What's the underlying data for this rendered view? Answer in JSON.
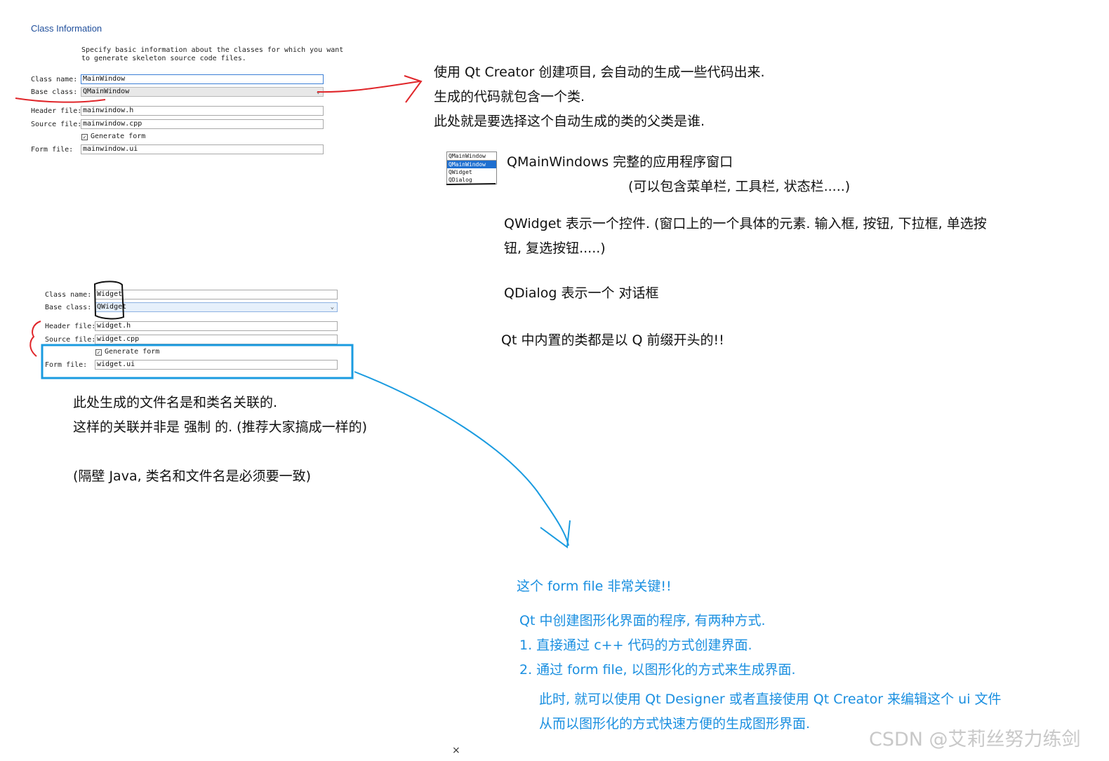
{
  "dialog1": {
    "title": "Class Information",
    "description_line1": "Specify basic information about the classes for which you want",
    "description_line2": "to generate skeleton source code files.",
    "class_name_label": "Class name:",
    "class_name_value": "MainWindow",
    "base_class_label": "Base class:",
    "base_class_value": "QMainWindow",
    "header_file_label": "Header file:",
    "header_file_value": "mainwindow.h",
    "source_file_label": "Source file:",
    "source_file_value": "mainwindow.cpp",
    "generate_form_label": "Generate form",
    "form_file_label": "Form file:",
    "form_file_value": "mainwindow.ui"
  },
  "dropdown": {
    "options": [
      "QMainWindow",
      "QMainWindow",
      "QWidget",
      "QDialog"
    ]
  },
  "dialog2": {
    "class_name_label": "Class name:",
    "class_name_value": "Widget",
    "base_class_label": "Base class:",
    "base_class_value": "QWidget",
    "header_file_label": "Header file:",
    "header_file_value": "widget.h",
    "source_file_label": "Source file:",
    "source_file_value": "widget.cpp",
    "generate_form_label": "Generate form",
    "form_file_label": "Form file:",
    "form_file_value": "widget.ui"
  },
  "notes": {
    "intro1": "使用 Qt Creator 创建项目, 会自动的生成一些代码出来.",
    "intro2": "生成的代码就包含一个类.",
    "intro3": "此处就是要选择这个自动生成的类的父类是谁.",
    "qmainwindow": "QMainWindows  完整的应用程序窗口",
    "qmainwindow_sub": "(可以包含菜单栏, 工具栏, 状态栏.....)",
    "qwidget1": "QWidget 表示一个控件. (窗口上的一个具体的元素. 输入框, 按钮, 下拉框, 单选按",
    "qwidget2": "钮, 复选按钮.....)",
    "qdialog": "QDialog 表示一个 对话框",
    "qprefix": "Qt 中内置的类都是以 Q 前缀开头的!!",
    "file1": "此处生成的文件名是和类名关联的.",
    "file2": "这样的关联并非是 强制 的. (推荐大家搞成一样的)",
    "java": "(隔壁 Java, 类名和文件名是必须要一致)",
    "form_key": "这个 form file 非常关键!!",
    "ways": "Qt 中创建图形化界面的程序, 有两种方式.",
    "way1": "1. 直接通过 c++ 代码的方式创建界面.",
    "way2": "2. 通过 form file, 以图形化的方式来生成界面.",
    "designer1": "此时, 就可以使用 Qt Designer 或者直接使用 Qt Creator 来编辑这个 ui 文件",
    "designer2": "从而以图形化的方式快速方便的生成图形界面."
  },
  "watermark": "CSDN @艾莉丝努力练剑",
  "close_glyph": "×",
  "colors": {
    "annotation_red": "#e0262a",
    "annotation_blue": "#1a9be0",
    "note_blue": "#1a8fe0",
    "title_blue": "#1f4e9b"
  }
}
